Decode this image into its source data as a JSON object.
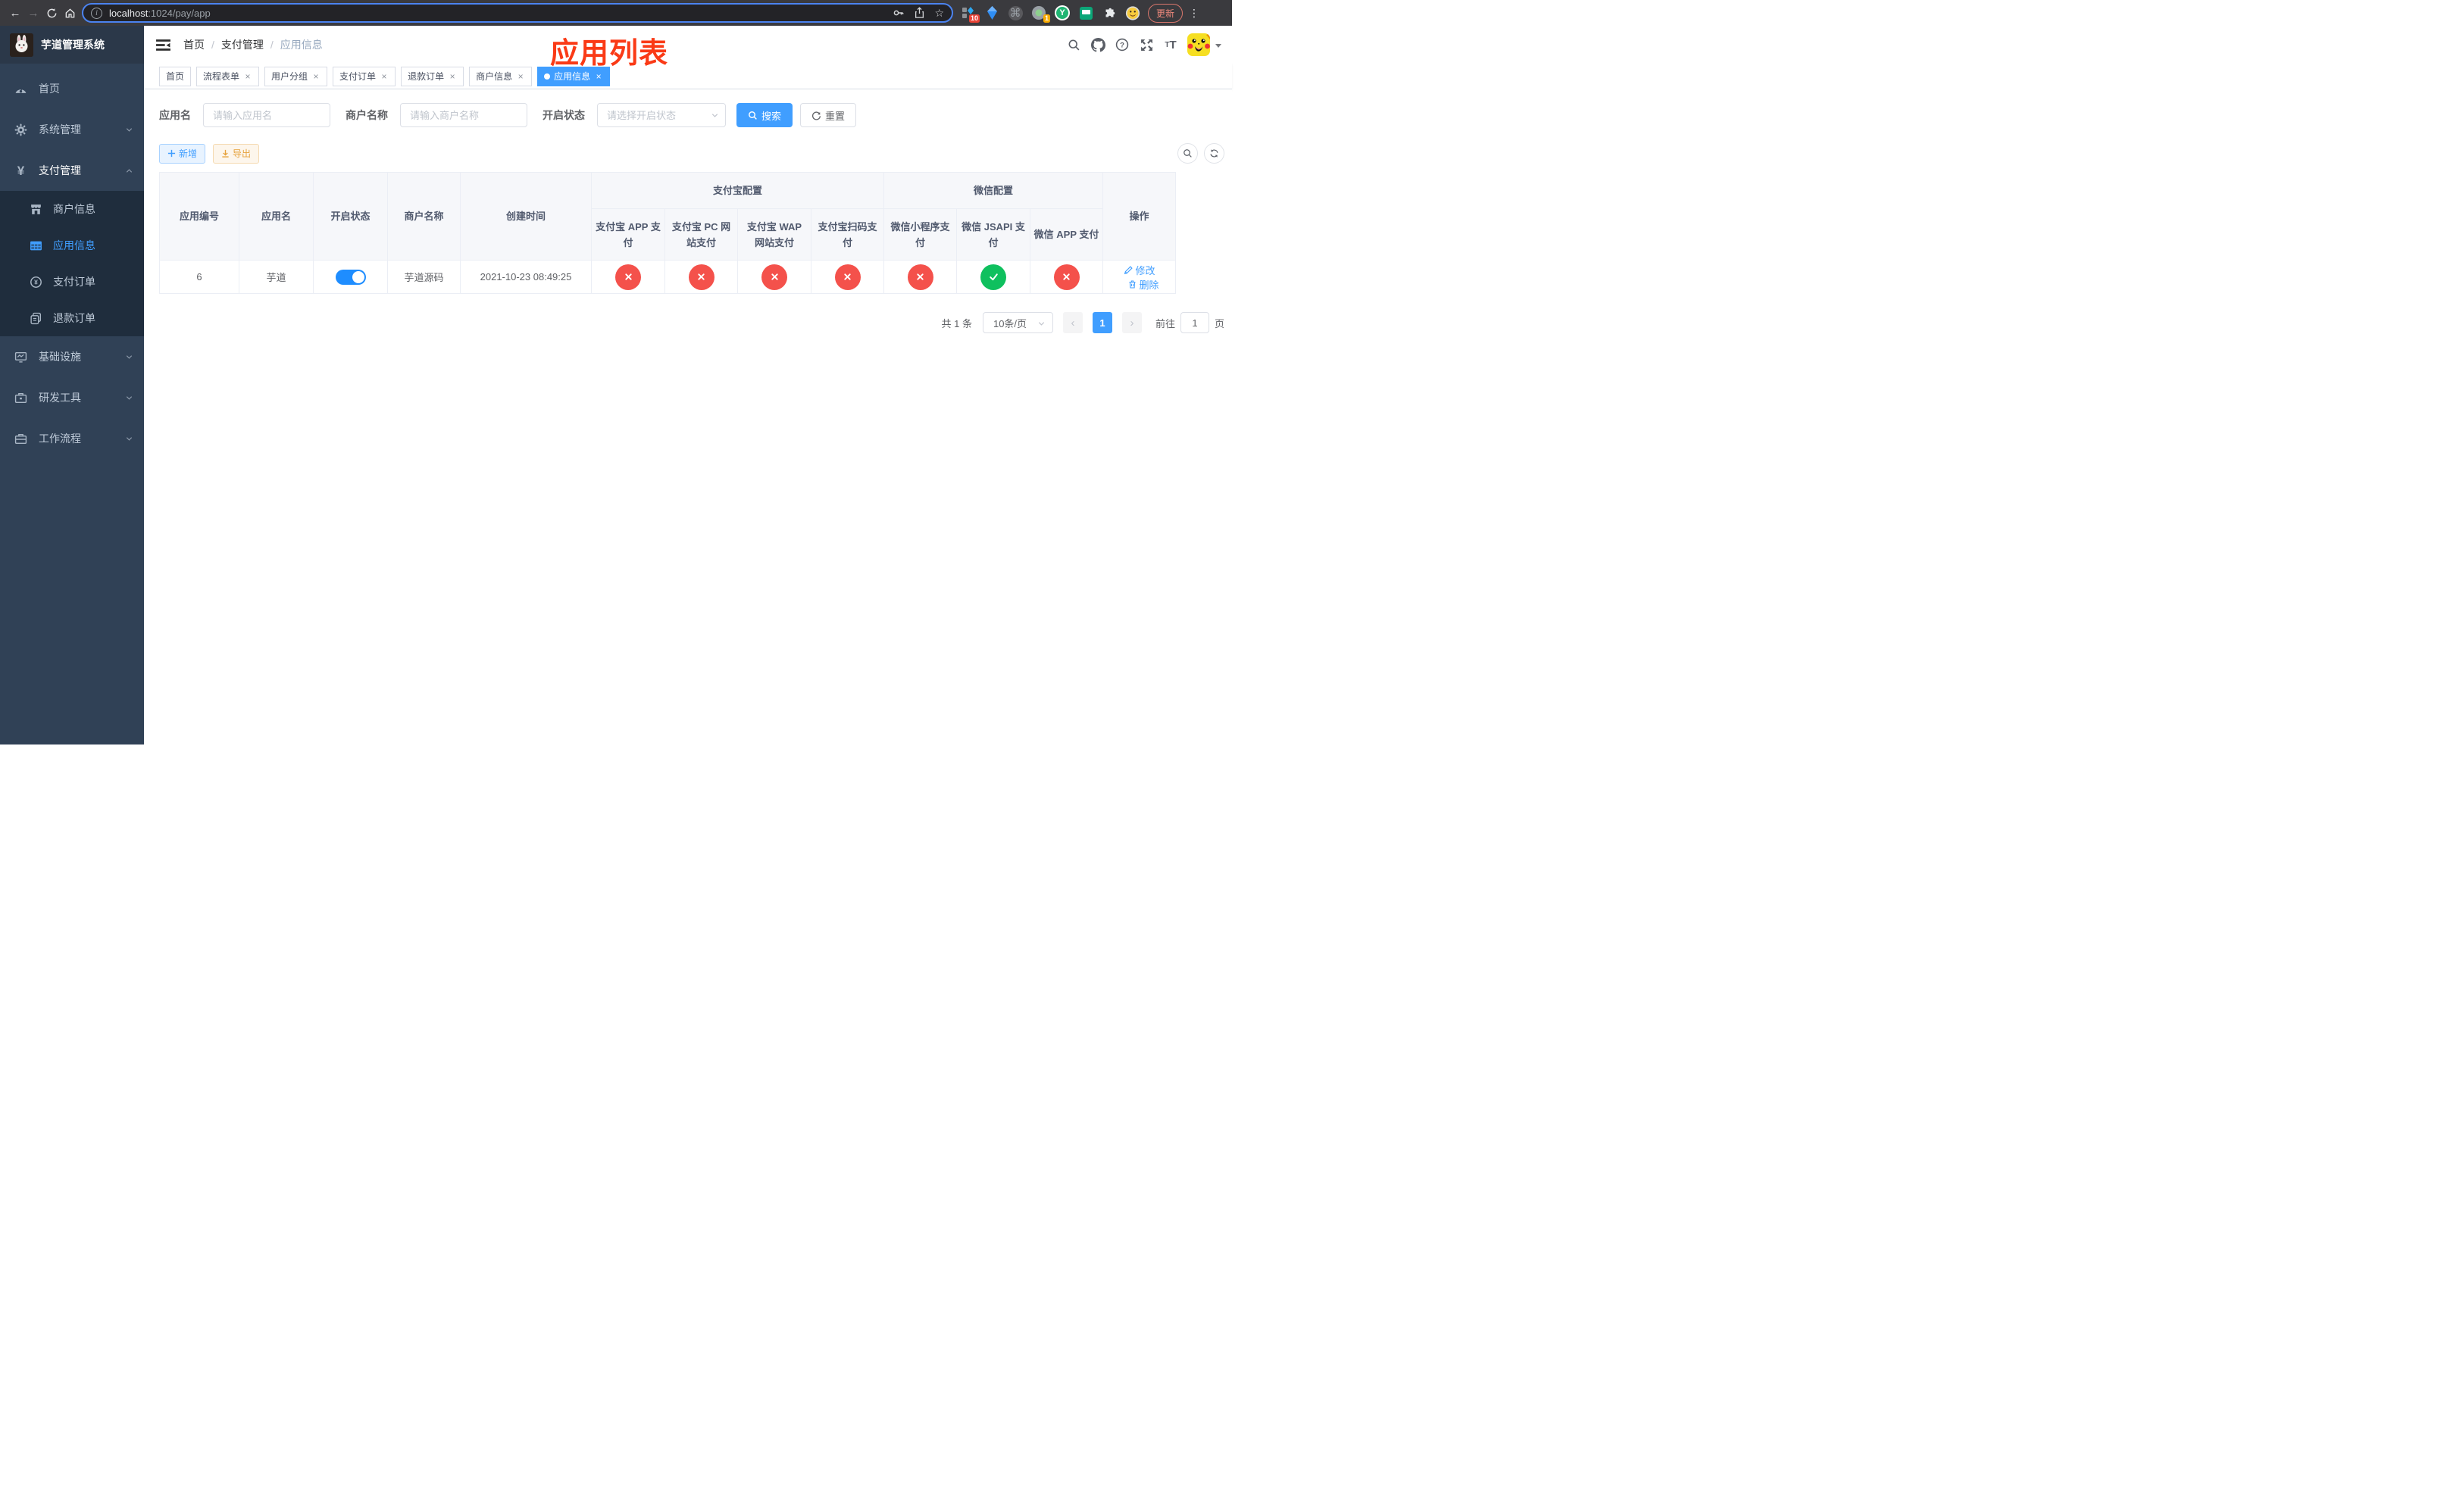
{
  "browser": {
    "url_host": "localhost",
    "url_path": ":1024/pay/app",
    "update_button": "更新",
    "extension_badge_a": "10",
    "extension_badge_b": "1",
    "vue_extension_letter": "Y",
    "command_glyph": "⌘"
  },
  "sidebar": {
    "app_title": "芋道管理系统",
    "menu": [
      {
        "label": "首页"
      },
      {
        "label": "系统管理"
      },
      {
        "label": "支付管理"
      },
      {
        "label": "商户信息"
      },
      {
        "label": "应用信息"
      },
      {
        "label": "支付订单"
      },
      {
        "label": "退款订单"
      },
      {
        "label": "基础设施"
      },
      {
        "label": "研发工具"
      },
      {
        "label": "工作流程"
      }
    ]
  },
  "navbar": {
    "breadcrumb": [
      {
        "label": "首页"
      },
      {
        "label": "支付管理"
      },
      {
        "label": "应用信息"
      }
    ],
    "annotation": "应用列表",
    "font_size_icon_text": "T"
  },
  "tabs": [
    {
      "label": "首页",
      "closable": false,
      "active": false
    },
    {
      "label": "流程表单",
      "closable": true,
      "active": false
    },
    {
      "label": "用户分组",
      "closable": true,
      "active": false
    },
    {
      "label": "支付订单",
      "closable": true,
      "active": false
    },
    {
      "label": "退款订单",
      "closable": true,
      "active": false
    },
    {
      "label": "商户信息",
      "closable": true,
      "active": false
    },
    {
      "label": "应用信息",
      "closable": true,
      "active": true
    }
  ],
  "filters": {
    "app_name_label": "应用名",
    "app_name_placeholder": "请输入应用名",
    "merchant_label": "商户名称",
    "merchant_placeholder": "请输入商户名称",
    "status_label": "开启状态",
    "status_placeholder": "请选择开启状态",
    "search_button": "搜索",
    "reset_button": "重置"
  },
  "toolbar": {
    "add_button": "新增",
    "export_button": "导出"
  },
  "table": {
    "columns": {
      "app_id": "应用编号",
      "app_name": "应用名",
      "status": "开启状态",
      "merchant": "商户名称",
      "created": "创建时间",
      "alipay_group": "支付宝配置",
      "wechat_group": "微信配置",
      "alipay_app": "支付宝 APP 支付",
      "alipay_pc": "支付宝 PC 网站支付",
      "alipay_wap": "支付宝 WAP 网站支付",
      "alipay_qr": "支付宝扫码支付",
      "wechat_lite": "微信小程序支付",
      "wechat_jsapi": "微信 JSAPI 支付",
      "wechat_app": "微信 APP 支付",
      "actions": "操作"
    },
    "rows": [
      {
        "app_id": "6",
        "app_name": "芋道",
        "enabled": true,
        "merchant": "芋道源码",
        "created": "2021-10-23 08:49:25",
        "channels": {
          "alipay_app": false,
          "alipay_pc": false,
          "alipay_wap": false,
          "alipay_qr": false,
          "wechat_lite": false,
          "wechat_jsapi": true,
          "wechat_app": false
        },
        "edit_action": "修改",
        "delete_action": "删除"
      }
    ]
  },
  "pagination": {
    "total": "共 1 条",
    "page_size": "10条/页",
    "current_page": "1",
    "goto_label": "前往",
    "goto_value": "1",
    "page_unit": "页"
  },
  "colors": {
    "accent": "#409eff",
    "success": "#0fc05e",
    "danger": "#f4514b",
    "warning": "#e6a23c",
    "sidebar_bg": "#304156",
    "submenu_bg": "#1f2d3d",
    "annotation": "#fa3a16"
  },
  "icons": [
    "back-icon",
    "forward-icon",
    "reload-icon",
    "home-icon",
    "info-icon",
    "key-icon",
    "share-icon",
    "star-icon",
    "extensions-badge-icon",
    "gem-icon",
    "command-icon",
    "recorder-icon",
    "vue-devtools-icon",
    "chat-icon",
    "puzzle-icon",
    "profile-emoji-icon",
    "kebab-icon",
    "hamburger-icon",
    "search-icon",
    "github-icon",
    "question-icon",
    "fullscreen-icon",
    "font-size-icon",
    "avatar",
    "dashboard-icon",
    "gear-icon",
    "yen-icon",
    "shop-icon",
    "grid-icon",
    "pay-order-icon",
    "refund-icon",
    "monitor-icon",
    "toolbox-icon",
    "workflow-icon",
    "plus-icon",
    "download-icon",
    "refresh-icon",
    "check-icon",
    "cross-icon",
    "edit-icon",
    "delete-icon"
  ]
}
